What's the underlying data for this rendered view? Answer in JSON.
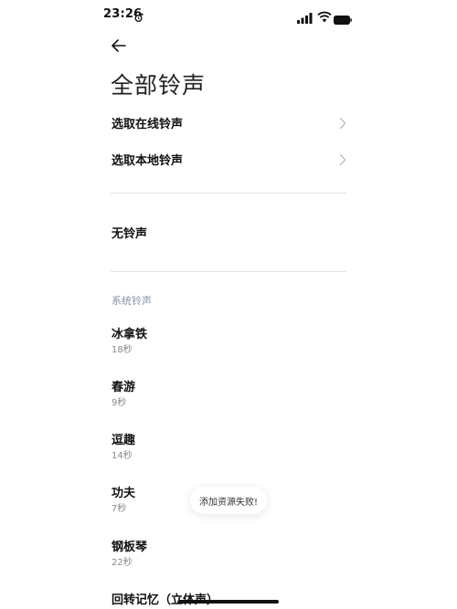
{
  "status_bar": {
    "time": "23:26"
  },
  "header": {
    "title": "全部铃声"
  },
  "nav": {
    "online_label": "选取在线铃声",
    "local_label": "选取本地铃声"
  },
  "no_ringtone_label": "无铃声",
  "section": {
    "system_label": "系统铃声"
  },
  "ringtones": [
    {
      "name": "冰拿铁",
      "duration": "18秒"
    },
    {
      "name": "春游",
      "duration": "9秒"
    },
    {
      "name": "逗趣",
      "duration": "14秒"
    },
    {
      "name": "功夫",
      "duration": "7秒"
    },
    {
      "name": "钢板琴",
      "duration": "22秒"
    },
    {
      "name": "回转记忆（立体声）",
      "duration": ""
    }
  ],
  "toast": {
    "message": "添加资源失败!"
  },
  "icons": {
    "back": "arrow-left-icon",
    "chevron": "chevron-right-icon",
    "alarm": "alarm-icon",
    "signal": "signal-icon",
    "wifi": "wifi-icon",
    "battery": "battery-icon"
  },
  "colors": {
    "text_primary": "#111111",
    "text_secondary": "#888888",
    "section_header": "#8a90a6",
    "divider": "#e3e3e3",
    "background": "#ffffff"
  }
}
